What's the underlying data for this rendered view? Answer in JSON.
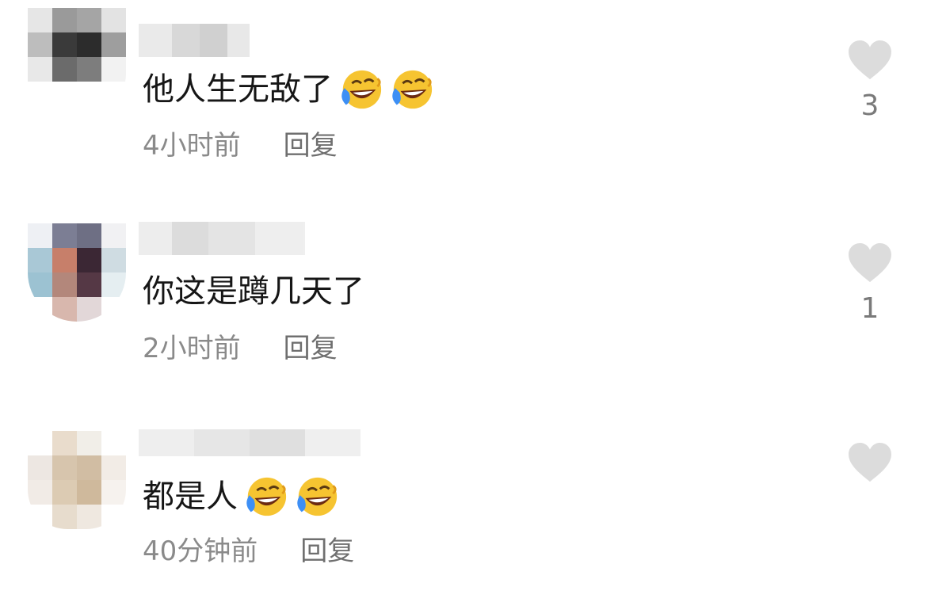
{
  "comments": [
    {
      "text": "他人生无敌了",
      "emojis": [
        "laughing-crying-emoji",
        "laughing-crying-emoji"
      ],
      "time": "4小时前",
      "reply_label": "回复",
      "likes": "3"
    },
    {
      "text": "你这是蹲几天了",
      "emojis": [],
      "time": "2小时前",
      "reply_label": "回复",
      "likes": "1"
    },
    {
      "text": "都是人",
      "emojis": [
        "laughing-crying-emoji",
        "laughing-crying-emoji"
      ],
      "time": "40分钟前",
      "reply_label": "回复",
      "likes": ""
    }
  ],
  "colors": {
    "text": "#161616",
    "meta": "#8a8a8a",
    "heart": "#dcdcdc",
    "emoji_face": "#f6c431",
    "emoji_tear": "#3d8ff5"
  }
}
